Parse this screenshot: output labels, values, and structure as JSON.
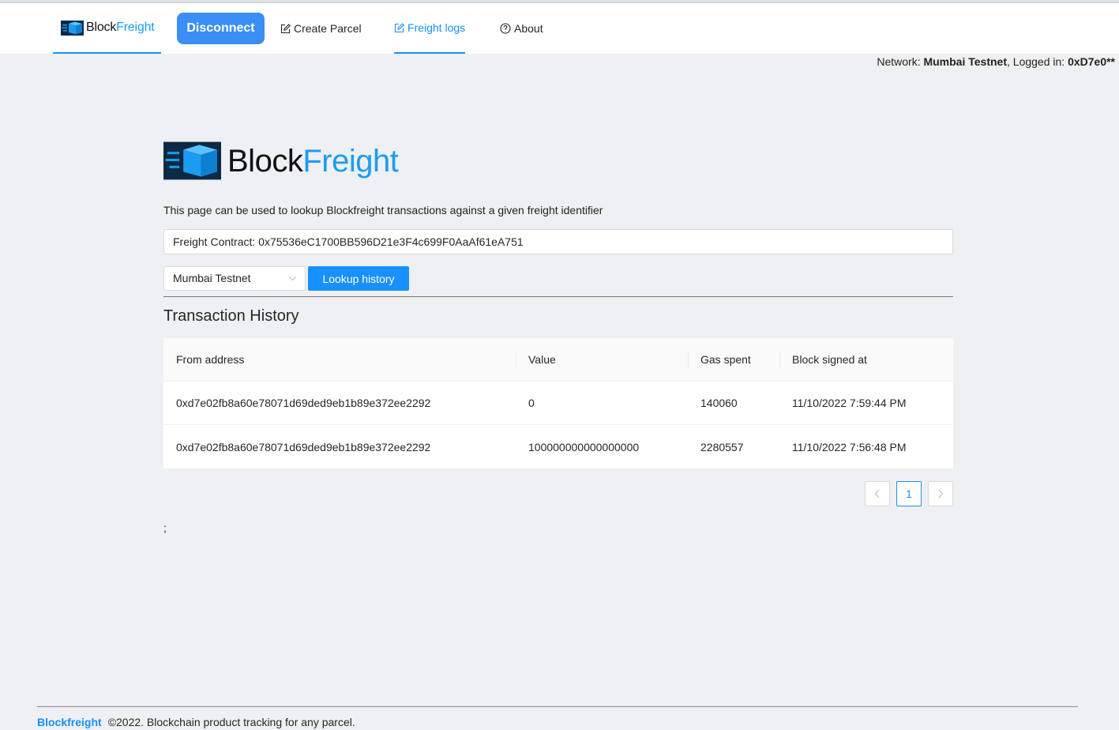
{
  "nav": {
    "brand": {
      "block": "Block",
      "freight": "Freight"
    },
    "disconnect_label": "Disconnect",
    "items": [
      {
        "label": "Create Parcel",
        "icon": "edit-icon"
      },
      {
        "label": "Freight logs",
        "icon": "edit-icon",
        "active": true
      },
      {
        "label": "About",
        "icon": "question-circle-icon"
      }
    ]
  },
  "status": {
    "network_prefix": "Network: ",
    "network": "Mumbai Testnet",
    "logged_prefix": ", Logged in: ",
    "account": "0xD7e0**"
  },
  "page": {
    "logo": {
      "block": "Block",
      "freight": "Freight"
    },
    "intro": "This page can be used to lookup Blockfreight transactions against a given freight identifier",
    "contract_value": "Freight Contract: 0x75536eC1700BB596D21e3F4c699F0AaAf61eA751",
    "network_selected": "Mumbai Testnet",
    "lookup_label": "Lookup history",
    "section_title": "Transaction History",
    "trailing_text": ";"
  },
  "table": {
    "columns": [
      "From address",
      "Value",
      "Gas spent",
      "Block signed at"
    ],
    "rows": [
      [
        "0xd7e02fb8a60e78071d69ded9eb1b89e372ee2292",
        "0",
        "140060",
        "11/10/2022 7:59:44 PM"
      ],
      [
        "0xd7e02fb8a60e78071d69ded9eb1b89e372ee2292",
        "100000000000000000",
        "2280557",
        "11/10/2022 7:56:48 PM"
      ]
    ]
  },
  "pagination": {
    "prev": "<",
    "current": "1",
    "next": ">"
  },
  "footer": {
    "brand": "Blockfreight",
    "text": "©2022. Blockchain product tracking for any parcel."
  },
  "colors": {
    "accent": "#1890ff",
    "disconnect": "#3a8ef5",
    "brand_freight": "#1b9cf2",
    "logo_bg": "#0d2a45"
  }
}
